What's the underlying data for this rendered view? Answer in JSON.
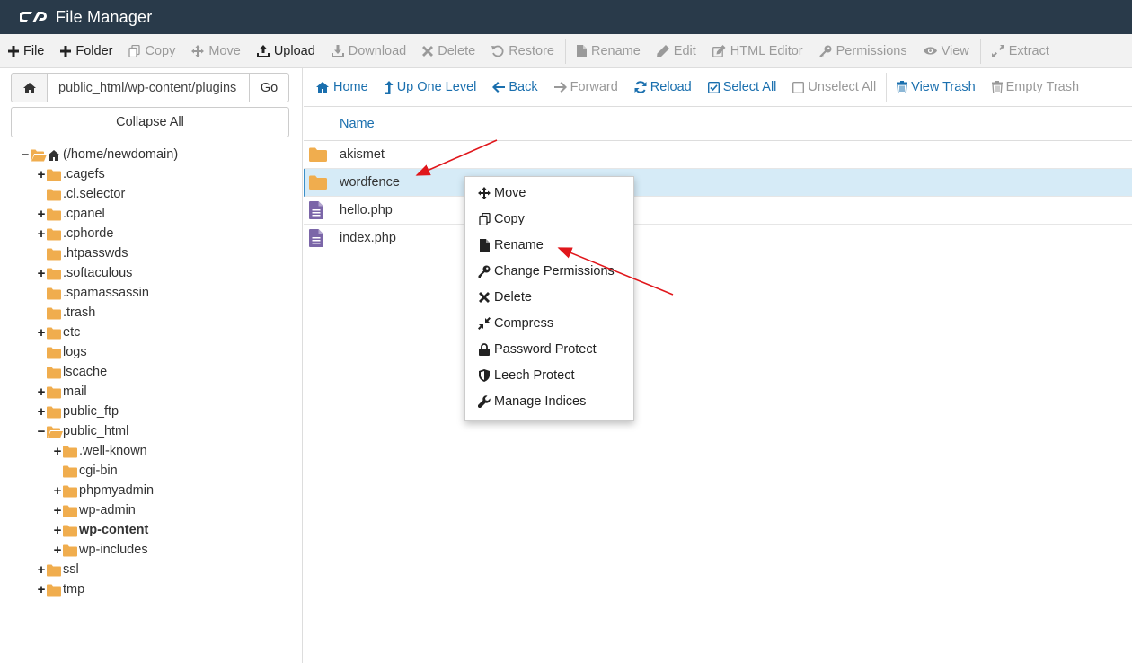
{
  "app": {
    "title": "File Manager"
  },
  "toolbar": {
    "items": [
      {
        "label": "File",
        "enabled": true,
        "icon": "plus-icon"
      },
      {
        "label": "Folder",
        "enabled": true,
        "icon": "plus-icon"
      },
      {
        "label": "Copy",
        "enabled": false,
        "icon": "copy-icon"
      },
      {
        "label": "Move",
        "enabled": false,
        "icon": "move-icon"
      },
      {
        "label": "Upload",
        "enabled": true,
        "icon": "upload-icon"
      },
      {
        "label": "Download",
        "enabled": false,
        "icon": "download-icon"
      },
      {
        "label": "Delete",
        "enabled": false,
        "icon": "close-icon"
      },
      {
        "label": "Restore",
        "enabled": false,
        "icon": "restore-icon"
      },
      {
        "label": "Rename",
        "enabled": false,
        "icon": "file-icon"
      },
      {
        "label": "Edit",
        "enabled": false,
        "icon": "pencil-icon"
      },
      {
        "label": "HTML Editor",
        "enabled": false,
        "icon": "edit-square-icon"
      },
      {
        "label": "Permissions",
        "enabled": false,
        "icon": "key-icon"
      },
      {
        "label": "View",
        "enabled": false,
        "icon": "eye-icon"
      },
      {
        "label": "Extract",
        "enabled": false,
        "icon": "expand-icon"
      }
    ]
  },
  "left": {
    "path_value": "public_html/wp-content/plugins",
    "go_label": "Go",
    "collapse_label": "Collapse All"
  },
  "tree": [
    {
      "label": "(/home/newdomain)",
      "depth": 0,
      "toggle": "−",
      "open": true,
      "home": true
    },
    {
      "label": ".cagefs",
      "depth": 1,
      "toggle": "+"
    },
    {
      "label": ".cl.selector",
      "depth": 1,
      "toggle": ""
    },
    {
      "label": ".cpanel",
      "depth": 1,
      "toggle": "+"
    },
    {
      "label": ".cphorde",
      "depth": 1,
      "toggle": "+"
    },
    {
      "label": ".htpasswds",
      "depth": 1,
      "toggle": ""
    },
    {
      "label": ".softaculous",
      "depth": 1,
      "toggle": "+"
    },
    {
      "label": ".spamassassin",
      "depth": 1,
      "toggle": ""
    },
    {
      "label": ".trash",
      "depth": 1,
      "toggle": ""
    },
    {
      "label": "etc",
      "depth": 1,
      "toggle": "+"
    },
    {
      "label": "logs",
      "depth": 1,
      "toggle": ""
    },
    {
      "label": "lscache",
      "depth": 1,
      "toggle": ""
    },
    {
      "label": "mail",
      "depth": 1,
      "toggle": "+"
    },
    {
      "label": "public_ftp",
      "depth": 1,
      "toggle": "+"
    },
    {
      "label": "public_html",
      "depth": 1,
      "toggle": "−",
      "open": true
    },
    {
      "label": ".well-known",
      "depth": 2,
      "toggle": "+"
    },
    {
      "label": "cgi-bin",
      "depth": 2,
      "toggle": ""
    },
    {
      "label": "phpmyadmin",
      "depth": 2,
      "toggle": "+"
    },
    {
      "label": "wp-admin",
      "depth": 2,
      "toggle": "+"
    },
    {
      "label": "wp-content",
      "depth": 2,
      "toggle": "+",
      "bold": true
    },
    {
      "label": "wp-includes",
      "depth": 2,
      "toggle": "+"
    },
    {
      "label": "ssl",
      "depth": 1,
      "toggle": "+"
    },
    {
      "label": "tmp",
      "depth": 1,
      "toggle": "+"
    }
  ],
  "rtoolbar": {
    "items": [
      {
        "label": "Home",
        "enabled": true,
        "icon": "home-icon"
      },
      {
        "label": "Up One Level",
        "enabled": true,
        "icon": "level-up-icon"
      },
      {
        "label": "Back",
        "enabled": true,
        "icon": "arrow-left-icon"
      },
      {
        "label": "Forward",
        "enabled": false,
        "icon": "arrow-right-icon"
      },
      {
        "label": "Reload",
        "enabled": true,
        "icon": "refresh-icon"
      },
      {
        "label": "Select All",
        "enabled": true,
        "icon": "checkbox-checked-icon"
      },
      {
        "label": "Unselect All",
        "enabled": false,
        "icon": "checkbox-empty-icon"
      },
      {
        "label": "View Trash",
        "enabled": true,
        "icon": "trash-icon"
      },
      {
        "label": "Empty Trash",
        "enabled": false,
        "icon": "trash-icon"
      }
    ]
  },
  "table": {
    "name_header": "Name",
    "rows": [
      {
        "name": "akismet",
        "type": "folder",
        "selected": false
      },
      {
        "name": "wordfence",
        "type": "folder",
        "selected": true
      },
      {
        "name": "hello.php",
        "type": "file",
        "selected": false
      },
      {
        "name": "index.php",
        "type": "file",
        "selected": false
      }
    ]
  },
  "context_menu": {
    "items": [
      {
        "label": "Move",
        "icon": "move-icon"
      },
      {
        "label": "Copy",
        "icon": "copy-icon"
      },
      {
        "label": "Rename",
        "icon": "file-icon"
      },
      {
        "label": "Change Permissions",
        "icon": "key-icon"
      },
      {
        "label": "Delete",
        "icon": "close-icon"
      },
      {
        "label": "Compress",
        "icon": "compress-icon"
      },
      {
        "label": "Password Protect",
        "icon": "lock-icon"
      },
      {
        "label": "Leech Protect",
        "icon": "shield-icon"
      },
      {
        "label": "Manage Indices",
        "icon": "wrench-icon"
      }
    ]
  },
  "colors": {
    "header_bg": "#293a4a",
    "link_blue": "#1a6fae",
    "folder": "#f0ad4e",
    "file": "#7b66a8",
    "selected_row": "#d6ebf7",
    "annotation_arrow": "#e0161b"
  }
}
